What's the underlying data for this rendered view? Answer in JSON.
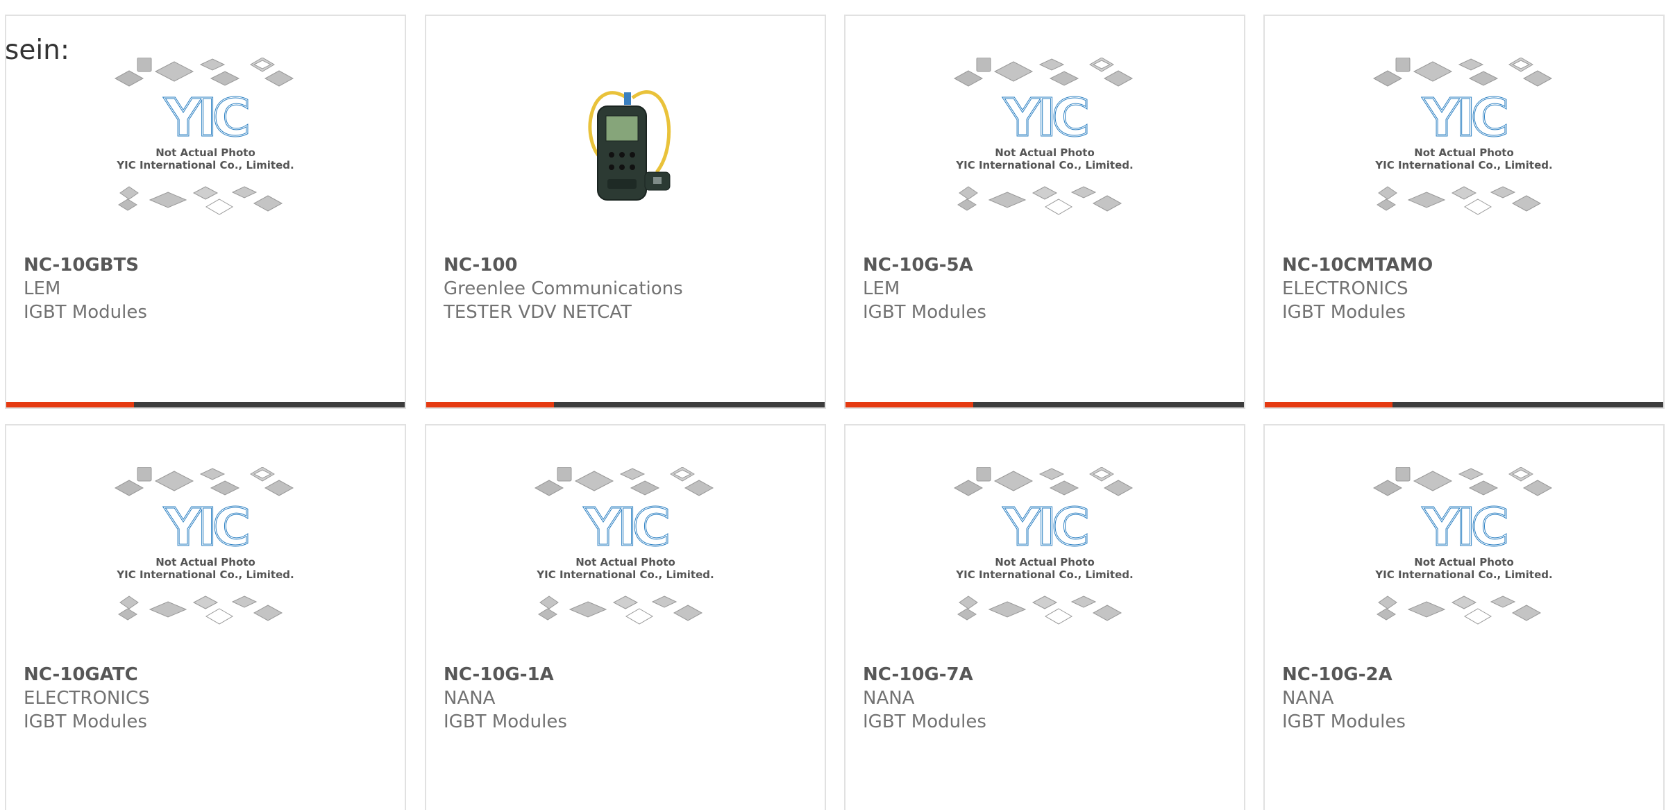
{
  "intro_text": "sein:",
  "placeholder": {
    "line1": "Not Actual Photo",
    "line2": "YIC International Co., Limited.",
    "logo": "YIC"
  },
  "colors": {
    "accent": "#e53a11",
    "bar": "#3d3d3d",
    "border": "#e1e1e1",
    "logo_blue": "#2a7fc2"
  },
  "products": [
    {
      "part": "NC-10GBTS",
      "manufacturer": "LEM",
      "category": "IGBT Modules",
      "image": "placeholder",
      "progress": 0.32
    },
    {
      "part": "NC-100",
      "manufacturer": "Greenlee Communications",
      "category": "TESTER VDV NETCAT",
      "image": "tester-device",
      "progress": 0.32
    },
    {
      "part": "NC-10G-5A",
      "manufacturer": "LEM",
      "category": "IGBT Modules",
      "image": "placeholder",
      "progress": 0.32
    },
    {
      "part": "NC-10CMTAMO",
      "manufacturer": "ELECTRONICS",
      "category": "IGBT Modules",
      "image": "placeholder",
      "progress": 0.32
    },
    {
      "part": "NC-10GATC",
      "manufacturer": "ELECTRONICS",
      "category": "IGBT Modules",
      "image": "placeholder"
    },
    {
      "part": "NC-10G-1A",
      "manufacturer": "NANA",
      "category": "IGBT Modules",
      "image": "placeholder"
    },
    {
      "part": "NC-10G-7A",
      "manufacturer": "NANA",
      "category": "IGBT Modules",
      "image": "placeholder"
    },
    {
      "part": "NC-10G-2A",
      "manufacturer": "NANA",
      "category": "IGBT Modules",
      "image": "placeholder"
    }
  ]
}
